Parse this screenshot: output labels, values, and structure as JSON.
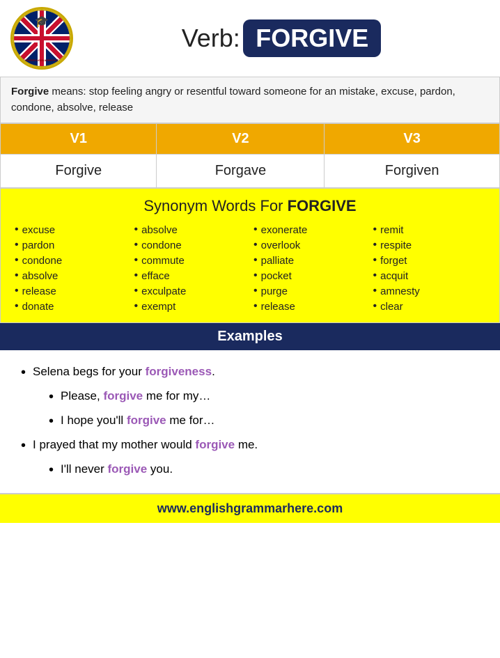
{
  "header": {
    "verb_label": "Verb:",
    "verb_word": "FORGIVE"
  },
  "definition": {
    "bold_word": "Forgive",
    "text": " means: stop feeling angry or resentful toward someone for an mistake, excuse, pardon, condone, absolve, release"
  },
  "conjugation": {
    "headers": [
      "V1",
      "V2",
      "V3"
    ],
    "forms": [
      "Forgive",
      "Forgave",
      "Forgiven"
    ]
  },
  "synonym": {
    "title_regular": "Synonym Words For ",
    "title_bold": "FORGIVE",
    "columns": [
      [
        "excuse",
        "pardon",
        "condone",
        "absolve",
        "release",
        "donate"
      ],
      [
        "absolve",
        "condone",
        "commute",
        "efface",
        "exculpate",
        "exempt"
      ],
      [
        "exonerate",
        "overlook",
        "palliate",
        "pocket",
        "purge",
        "release"
      ],
      [
        "remit",
        "respite",
        "forget",
        "acquit",
        "amnesty",
        "clear"
      ]
    ]
  },
  "examples": {
    "header": "Examples",
    "items": [
      {
        "text_before": "Selena begs for your ",
        "highlight": "forgiveness",
        "text_after": "."
      },
      {
        "text_before": "Please, ",
        "highlight": "forgive",
        "text_after": " me for my…"
      },
      {
        "text_before": "I hope you'll ",
        "highlight": "forgive",
        "text_after": " me for…"
      },
      {
        "text_before": "I prayed that my mother would ",
        "highlight": "forgive",
        "text_after": " me."
      },
      {
        "text_before": "I'll never ",
        "highlight": "forgive",
        "text_after": " you."
      }
    ]
  },
  "footer": {
    "url": "www.englishgrammarhere.com"
  }
}
